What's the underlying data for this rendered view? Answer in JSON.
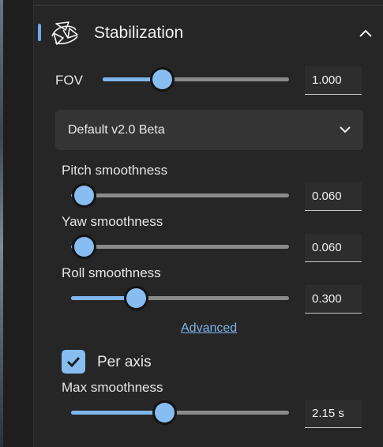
{
  "section": {
    "title": "Stabilization"
  },
  "fov": {
    "label": "FOV",
    "value": "1.000",
    "level": 0.318
  },
  "preset": {
    "selected": "Default v2.0 Beta"
  },
  "pitch": {
    "label": "Pitch smoothness",
    "value": "0.060",
    "level": 0.06
  },
  "yaw": {
    "label": "Yaw smoothness",
    "value": "0.060",
    "level": 0.06
  },
  "roll": {
    "label": "Roll smoothness",
    "value": "0.300",
    "level": 0.3
  },
  "advanced": {
    "label": "Advanced"
  },
  "per_axis": {
    "label": "Per axis",
    "checked": true
  },
  "max_smoothness": {
    "label": "Max smoothness",
    "value": "2.15 s",
    "level": 0.43
  },
  "colors": {
    "accent": "#7fb6ee",
    "track": "#8a8a8a",
    "panel": "#262626"
  },
  "icons": {
    "section": "stabilization-icon",
    "collapse": "chevron-up-icon",
    "dropdown": "chevron-down-icon",
    "check": "checkmark-icon"
  }
}
